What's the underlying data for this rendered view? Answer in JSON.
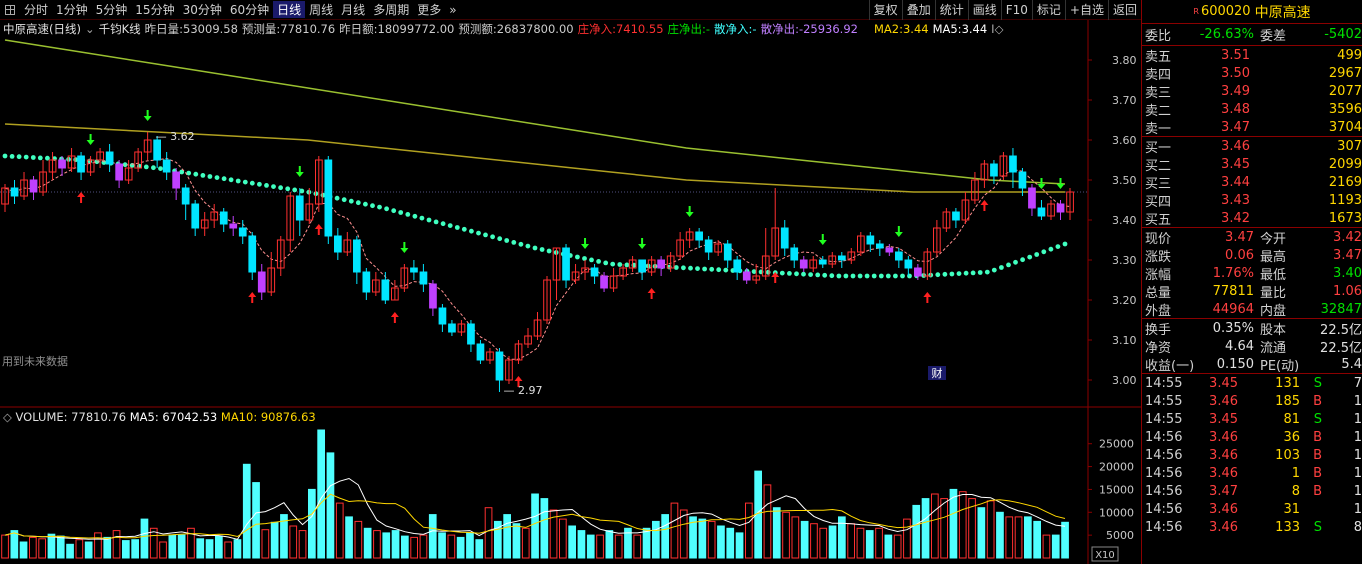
{
  "toolbar": {
    "periods": [
      "分时",
      "1分钟",
      "5分钟",
      "15分钟",
      "30分钟",
      "60分钟",
      "日线",
      "周线",
      "月线",
      "多周期",
      "更多"
    ],
    "active_period": "日线",
    "more_arrow": "»",
    "tools": [
      "复权",
      "叠加",
      "统计",
      "画线",
      "F10",
      "标记",
      "+自选",
      "返回"
    ]
  },
  "info": {
    "stock": "中原高速(日线)",
    "chart_type": "千钧K线",
    "prev_vol_label": "昨日量:",
    "prev_vol": "53009.58",
    "est_vol_label": "预测量:",
    "est_vol": "77810.76",
    "prev_amt_label": "昨日额:",
    "prev_amt": "18099772.00",
    "est_amt_label": "预测额:",
    "est_amt": "26837800.00",
    "inst_in_label": "庄净入:",
    "inst_in": "7410.55",
    "inst_out_label": "庄净出:",
    "inst_out": "-",
    "retail_in_label": "散净入:",
    "retail_in": "-",
    "retail_out_label": "散净出:",
    "retail_out": "-25936.92",
    "ma2_label": "MA2:",
    "ma2": "3.44",
    "ma5_label": "MA5:",
    "ma5": "3.44"
  },
  "annotations": {
    "future_data": "用到未来数据",
    "high_label": "3.62",
    "low_label": "2.97",
    "fin_marker": "财"
  },
  "volume_info": {
    "label": "VOLUME:",
    "volume": "77810.76",
    "ma5_label": "MA5:",
    "ma5": "67042.53",
    "ma10_label": "MA10:",
    "ma10": "90876.63",
    "unit": "X10"
  },
  "colors": {
    "up": "#ff3030",
    "down": "#00e5ff",
    "purple": "#c040ff",
    "ma_green": "#9ac030",
    "ma_olive": "#b0a020",
    "dots": "#40ffc0",
    "axis": "#8b0000"
  },
  "chart_data": [
    {
      "type": "candlestick",
      "ylim": [
        2.95,
        3.85
      ],
      "yticks": [
        3.0,
        3.1,
        3.2,
        3.3,
        3.4,
        3.5,
        3.6,
        3.7,
        3.8
      ],
      "candles": [
        [
          3.44,
          3.48,
          3.42,
          3.49
        ],
        [
          3.48,
          3.46,
          3.44,
          3.5
        ],
        [
          3.46,
          3.5,
          3.45,
          3.52
        ],
        [
          3.5,
          3.47,
          3.45,
          3.51
        ],
        [
          3.47,
          3.52,
          3.46,
          3.55
        ],
        [
          3.52,
          3.55,
          3.5,
          3.57
        ],
        [
          3.55,
          3.53,
          3.51,
          3.56
        ],
        [
          3.53,
          3.56,
          3.52,
          3.58
        ],
        [
          3.56,
          3.52,
          3.5,
          3.57
        ],
        [
          3.52,
          3.55,
          3.51,
          3.56
        ],
        [
          3.55,
          3.57,
          3.53,
          3.58
        ],
        [
          3.57,
          3.54,
          3.52,
          3.59
        ],
        [
          3.54,
          3.5,
          3.48,
          3.55
        ],
        [
          3.5,
          3.53,
          3.49,
          3.55
        ],
        [
          3.53,
          3.57,
          3.52,
          3.58
        ],
        [
          3.57,
          3.6,
          3.55,
          3.62
        ],
        [
          3.6,
          3.55,
          3.53,
          3.61
        ],
        [
          3.55,
          3.52,
          3.5,
          3.57
        ],
        [
          3.52,
          3.48,
          3.45,
          3.53
        ],
        [
          3.48,
          3.44,
          3.4,
          3.49
        ],
        [
          3.44,
          3.38,
          3.36,
          3.45
        ],
        [
          3.38,
          3.4,
          3.36,
          3.42
        ],
        [
          3.4,
          3.42,
          3.38,
          3.44
        ],
        [
          3.42,
          3.39,
          3.37,
          3.43
        ],
        [
          3.39,
          3.38,
          3.36,
          3.41
        ],
        [
          3.38,
          3.36,
          3.34,
          3.4
        ],
        [
          3.36,
          3.27,
          3.25,
          3.37
        ],
        [
          3.27,
          3.22,
          3.2,
          3.29
        ],
        [
          3.22,
          3.28,
          3.21,
          3.32
        ],
        [
          3.28,
          3.35,
          3.26,
          3.36
        ],
        [
          3.35,
          3.46,
          3.32,
          3.47
        ],
        [
          3.46,
          3.4,
          3.36,
          3.48
        ],
        [
          3.4,
          3.44,
          3.39,
          3.48
        ],
        [
          3.44,
          3.55,
          3.42,
          3.56
        ],
        [
          3.55,
          3.36,
          3.34,
          3.56
        ],
        [
          3.36,
          3.32,
          3.3,
          3.38
        ],
        [
          3.32,
          3.35,
          3.31,
          3.37
        ],
        [
          3.35,
          3.27,
          3.24,
          3.36
        ],
        [
          3.27,
          3.22,
          3.2,
          3.28
        ],
        [
          3.22,
          3.25,
          3.21,
          3.27
        ],
        [
          3.25,
          3.2,
          3.19,
          3.27
        ],
        [
          3.2,
          3.23,
          3.2,
          3.25
        ],
        [
          3.23,
          3.28,
          3.22,
          3.29
        ],
        [
          3.28,
          3.27,
          3.25,
          3.3
        ],
        [
          3.27,
          3.24,
          3.22,
          3.29
        ],
        [
          3.24,
          3.18,
          3.16,
          3.25
        ],
        [
          3.18,
          3.14,
          3.12,
          3.19
        ],
        [
          3.14,
          3.12,
          3.11,
          3.15
        ],
        [
          3.12,
          3.14,
          3.11,
          3.15
        ],
        [
          3.14,
          3.09,
          3.07,
          3.15
        ],
        [
          3.09,
          3.05,
          3.04,
          3.1
        ],
        [
          3.05,
          3.07,
          3.04,
          3.08
        ],
        [
          3.07,
          3.0,
          2.97,
          3.08
        ],
        [
          3.0,
          3.05,
          2.99,
          3.06
        ],
        [
          3.05,
          3.09,
          3.04,
          3.1
        ],
        [
          3.09,
          3.11,
          3.08,
          3.13
        ],
        [
          3.11,
          3.15,
          3.1,
          3.17
        ],
        [
          3.15,
          3.25,
          3.14,
          3.26
        ],
        [
          3.25,
          3.33,
          3.2,
          3.33
        ],
        [
          3.33,
          3.25,
          3.23,
          3.34
        ],
        [
          3.25,
          3.27,
          3.24,
          3.29
        ],
        [
          3.27,
          3.28,
          3.25,
          3.3
        ],
        [
          3.28,
          3.26,
          3.24,
          3.29
        ],
        [
          3.26,
          3.23,
          3.22,
          3.27
        ],
        [
          3.23,
          3.26,
          3.22,
          3.28
        ],
        [
          3.26,
          3.28,
          3.25,
          3.29
        ],
        [
          3.28,
          3.3,
          3.27,
          3.31
        ],
        [
          3.3,
          3.27,
          3.25,
          3.3
        ],
        [
          3.27,
          3.3,
          3.26,
          3.31
        ],
        [
          3.3,
          3.28,
          3.26,
          3.31
        ],
        [
          3.28,
          3.31,
          3.27,
          3.32
        ],
        [
          3.31,
          3.35,
          3.3,
          3.37
        ],
        [
          3.35,
          3.37,
          3.33,
          3.38
        ],
        [
          3.37,
          3.35,
          3.33,
          3.38
        ],
        [
          3.35,
          3.32,
          3.3,
          3.36
        ],
        [
          3.32,
          3.34,
          3.31,
          3.35
        ],
        [
          3.34,
          3.3,
          3.28,
          3.35
        ],
        [
          3.3,
          3.27,
          3.25,
          3.31
        ],
        [
          3.27,
          3.25,
          3.24,
          3.28
        ],
        [
          3.25,
          3.26,
          3.24,
          3.29
        ],
        [
          3.26,
          3.31,
          3.25,
          3.38
        ],
        [
          3.31,
          3.38,
          3.3,
          3.48
        ],
        [
          3.38,
          3.33,
          3.31,
          3.4
        ],
        [
          3.33,
          3.3,
          3.28,
          3.34
        ],
        [
          3.3,
          3.28,
          3.27,
          3.31
        ],
        [
          3.28,
          3.3,
          3.27,
          3.31
        ],
        [
          3.3,
          3.29,
          3.28,
          3.31
        ],
        [
          3.29,
          3.31,
          3.28,
          3.32
        ],
        [
          3.31,
          3.3,
          3.28,
          3.32
        ],
        [
          3.3,
          3.32,
          3.29,
          3.33
        ],
        [
          3.32,
          3.36,
          3.31,
          3.37
        ],
        [
          3.36,
          3.34,
          3.32,
          3.37
        ],
        [
          3.34,
          3.33,
          3.31,
          3.35
        ],
        [
          3.33,
          3.32,
          3.31,
          3.34
        ],
        [
          3.32,
          3.3,
          3.28,
          3.33
        ],
        [
          3.3,
          3.28,
          3.26,
          3.31
        ],
        [
          3.28,
          3.26,
          3.25,
          3.29
        ],
        [
          3.26,
          3.32,
          3.25,
          3.33
        ],
        [
          3.32,
          3.38,
          3.31,
          3.4
        ],
        [
          3.38,
          3.42,
          3.37,
          3.43
        ],
        [
          3.42,
          3.4,
          3.38,
          3.43
        ],
        [
          3.4,
          3.45,
          3.39,
          3.47
        ],
        [
          3.45,
          3.5,
          3.44,
          3.52
        ],
        [
          3.5,
          3.54,
          3.48,
          3.55
        ],
        [
          3.54,
          3.51,
          3.49,
          3.55
        ],
        [
          3.51,
          3.56,
          3.5,
          3.57
        ],
        [
          3.56,
          3.52,
          3.48,
          3.58
        ],
        [
          3.52,
          3.48,
          3.46,
          3.53
        ],
        [
          3.48,
          3.43,
          3.41,
          3.49
        ],
        [
          3.43,
          3.41,
          3.4,
          3.45
        ],
        [
          3.41,
          3.44,
          3.4,
          3.45
        ],
        [
          3.44,
          3.42,
          3.4,
          3.45
        ],
        [
          3.42,
          3.47,
          3.4,
          3.48
        ]
      ],
      "ma_long": [
        3.64,
        3.63,
        3.62,
        3.61,
        3.6,
        3.58,
        3.56,
        3.54,
        3.52,
        3.5,
        3.49,
        3.48,
        3.47,
        3.47,
        3.47
      ],
      "ma_mid": [
        3.85,
        3.82,
        3.79,
        3.76,
        3.73,
        3.7,
        3.67,
        3.64,
        3.61,
        3.58,
        3.56,
        3.54,
        3.52,
        3.5,
        3.49
      ],
      "dotted_ma": [
        3.56,
        3.55,
        3.53,
        3.5,
        3.47,
        3.43,
        3.38,
        3.33,
        3.29,
        3.28,
        3.27,
        3.26,
        3.26,
        3.27,
        3.34
      ],
      "buy_signals": [
        8,
        26,
        33,
        41,
        54,
        68,
        81,
        97,
        103
      ],
      "sell_signals": [
        9,
        15,
        31,
        42,
        61,
        67,
        72,
        86,
        94,
        109,
        111
      ]
    },
    {
      "type": "bar",
      "ylim": [
        0,
        28000
      ],
      "yticks": [
        5000,
        10000,
        15000,
        20000,
        25000
      ],
      "values": [
        5000,
        6000,
        3500,
        4500,
        4200,
        5200,
        4800,
        3000,
        4000,
        3500,
        5500,
        4500,
        6000,
        3800,
        4000,
        8500,
        6500,
        3500,
        5000,
        5000,
        6500,
        4200,
        4000,
        4800,
        3500,
        4000,
        20500,
        16500,
        6200,
        7800,
        9500,
        7000,
        6000,
        15000,
        28000,
        23000,
        12000,
        9000,
        8000,
        6500,
        6000,
        5500,
        6000,
        4800,
        4500,
        5000,
        9500,
        5500,
        5000,
        4500,
        5500,
        4000,
        11000,
        8000,
        9500,
        7500,
        6500,
        14000,
        13000,
        10500,
        8500,
        7000,
        6000,
        5000,
        5000,
        6000,
        5000,
        6500,
        5000,
        6500,
        8000,
        9500,
        12000,
        10500,
        9000,
        8500,
        8000,
        7000,
        6500,
        5500,
        12000,
        19000,
        16000,
        11000,
        10000,
        9000,
        8000,
        7500,
        6500,
        7000,
        9000,
        7500,
        6500,
        6000,
        6500,
        5000,
        5000,
        8500,
        11500,
        13000,
        14000,
        13000,
        15000,
        14500,
        13000,
        11000,
        12500,
        10000,
        9000,
        9000,
        9000,
        8000,
        5000,
        5000,
        7800
      ]
    }
  ],
  "quote": {
    "title_sup": "R",
    "code": "600020",
    "name": "中原高速",
    "ratio_label": "委比",
    "ratio": "-26.63%",
    "diff_label": "委差",
    "diff": "-5402",
    "asks": [
      {
        "label": "卖五",
        "price": "3.51",
        "vol": "499"
      },
      {
        "label": "卖四",
        "price": "3.50",
        "vol": "2967"
      },
      {
        "label": "卖三",
        "price": "3.49",
        "vol": "2077"
      },
      {
        "label": "卖二",
        "price": "3.48",
        "vol": "3596"
      },
      {
        "label": "卖一",
        "price": "3.47",
        "vol": "3704"
      }
    ],
    "bids": [
      {
        "label": "买一",
        "price": "3.46",
        "vol": "307"
      },
      {
        "label": "买二",
        "price": "3.45",
        "vol": "2099"
      },
      {
        "label": "买三",
        "price": "3.44",
        "vol": "2169"
      },
      {
        "label": "买四",
        "price": "3.43",
        "vol": "1193"
      },
      {
        "label": "买五",
        "price": "3.42",
        "vol": "1673"
      }
    ],
    "stats": [
      {
        "l1": "现价",
        "v1": "3.47",
        "c1": "red",
        "l2": "今开",
        "v2": "3.42",
        "c2": "red"
      },
      {
        "l1": "涨跌",
        "v1": "0.06",
        "c1": "red",
        "l2": "最高",
        "v2": "3.47",
        "c2": "red"
      },
      {
        "l1": "涨幅",
        "v1": "1.76%",
        "c1": "red",
        "l2": "最低",
        "v2": "3.40",
        "c2": "green"
      },
      {
        "l1": "总量",
        "v1": "77811",
        "c1": "yellow",
        "l2": "量比",
        "v2": "1.06",
        "c2": "red"
      },
      {
        "l1": "外盘",
        "v1": "44964",
        "c1": "red",
        "l2": "内盘",
        "v2": "32847",
        "c2": "green"
      }
    ],
    "fund": [
      {
        "l1": "换手",
        "v1": "0.35%",
        "c1": "white",
        "l2": "股本",
        "v2": "22.5亿",
        "c2": "white"
      },
      {
        "l1": "净资",
        "v1": "4.64",
        "c1": "white",
        "l2": "流通",
        "v2": "22.5亿",
        "c2": "white"
      },
      {
        "l1": "收益(一)",
        "v1": "0.150",
        "c1": "white",
        "l2": "PE(动)",
        "v2": "5.4",
        "c2": "white"
      }
    ],
    "ticks": [
      {
        "time": "14:55",
        "price": "3.45",
        "pc": "red",
        "vol": "131",
        "bs": "S",
        "n": "7"
      },
      {
        "time": "14:55",
        "price": "3.46",
        "pc": "red",
        "vol": "185",
        "bs": "B",
        "n": "1"
      },
      {
        "time": "14:55",
        "price": "3.45",
        "pc": "red",
        "vol": "81",
        "bs": "S",
        "n": "1"
      },
      {
        "time": "14:56",
        "price": "3.46",
        "pc": "red",
        "vol": "36",
        "bs": "B",
        "n": "1"
      },
      {
        "time": "14:56",
        "price": "3.46",
        "pc": "red",
        "vol": "103",
        "bs": "B",
        "n": "1"
      },
      {
        "time": "14:56",
        "price": "3.46",
        "pc": "red",
        "vol": "1",
        "bs": "B",
        "n": "1"
      },
      {
        "time": "14:56",
        "price": "3.47",
        "pc": "red",
        "vol": "8",
        "bs": "B",
        "n": "1"
      },
      {
        "time": "14:56",
        "price": "3.46",
        "pc": "red",
        "vol": "31",
        "bs": "",
        "n": "1"
      },
      {
        "time": "14:56",
        "price": "3.46",
        "pc": "red",
        "vol": "133",
        "bs": "S",
        "n": "8"
      }
    ]
  }
}
